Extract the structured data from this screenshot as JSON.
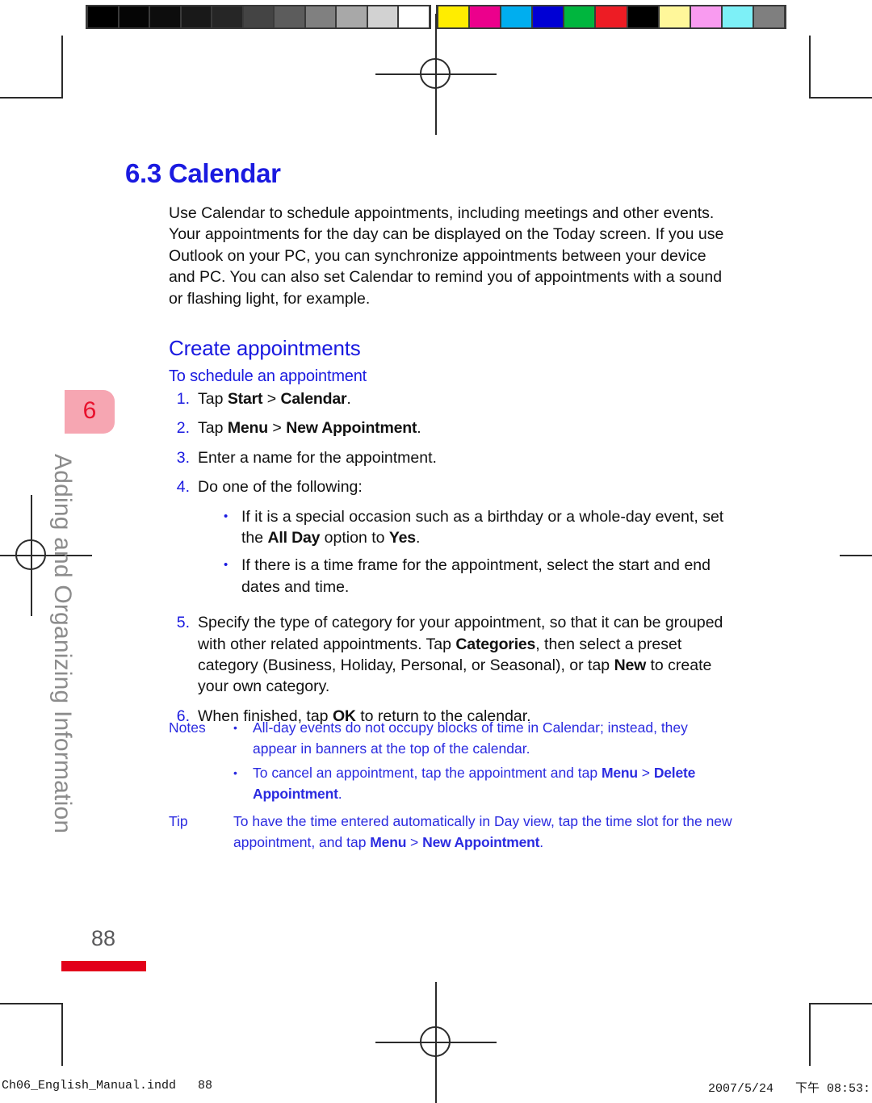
{
  "calibration": {
    "grayscale_label": "grayscale-calibration-strip",
    "grayscale_swatches": [
      "#000000",
      "#050505",
      "#0d0d0d",
      "#191919",
      "#262626",
      "#444444",
      "#5c5c5c",
      "#808080",
      "#a8a8a8",
      "#d2d2d2",
      "#ffffff"
    ],
    "color_label": "color-calibration-strip",
    "color_swatches": [
      "#ffed00",
      "#ec008c",
      "#00aeef",
      "#0000d4",
      "#00b63e",
      "#ed1c24",
      "#000000",
      "#fff79a",
      "#f99bf0",
      "#7df0f7",
      "#7f7f7f"
    ]
  },
  "chapter_tab": {
    "number": "6",
    "vertical_title": "Adding and Organizing Information",
    "tab_color": "#f6a6b2",
    "number_color": "#e8112d",
    "title_color": "#8c8c8c"
  },
  "page": {
    "section_title": "6.3 Calendar",
    "accent_color": "#1a1ae0",
    "intro_paragraph": "Use Calendar to schedule appointments, including meetings and other events. Your appointments for the day can be displayed on the Today screen. If you use Outlook on your PC, you can synchronize appointments between your device and PC. You can also set Calendar to remind you of appointments with a sound or flashing light, for example.",
    "subsection_title": "Create appointments",
    "procedure_title": "To schedule an appointment",
    "page_number": "88",
    "page_rule_color": "#e2001a"
  },
  "steps": [
    {
      "num": "1.",
      "parts": [
        {
          "t": "Tap ",
          "ui": false
        },
        {
          "t": "Start",
          "ui": true
        },
        {
          "t": " > ",
          "ui": false
        },
        {
          "t": "Calendar",
          "ui": true
        },
        {
          "t": ".",
          "ui": false
        }
      ]
    },
    {
      "num": "2.",
      "parts": [
        {
          "t": "Tap ",
          "ui": false
        },
        {
          "t": "Menu",
          "ui": true
        },
        {
          "t": " > ",
          "ui": false
        },
        {
          "t": "New Appointment",
          "ui": true
        },
        {
          "t": ".",
          "ui": false
        }
      ]
    },
    {
      "num": "3.",
      "parts": [
        {
          "t": "Enter a name for the appointment.",
          "ui": false
        }
      ]
    },
    {
      "num": "4.",
      "parts": [
        {
          "t": "Do one of the following:",
          "ui": false
        }
      ],
      "sublist": [
        {
          "bullet": "•",
          "parts": [
            {
              "t": "If it is a special occasion such as a birthday or a whole-day event, set the ",
              "ui": false
            },
            {
              "t": "All Day",
              "ui": true
            },
            {
              "t": " option to ",
              "ui": false
            },
            {
              "t": "Yes",
              "ui": true
            },
            {
              "t": ".",
              "ui": false
            }
          ]
        },
        {
          "bullet": "•",
          "parts": [
            {
              "t": "If there is a time frame for the appointment, select the start and end dates and time.",
              "ui": false
            }
          ]
        }
      ]
    },
    {
      "num": "5.",
      "parts": [
        {
          "t": "Specify the type of category for your appointment, so that it can be grouped with other related appointments. Tap ",
          "ui": false
        },
        {
          "t": "Categories",
          "ui": true
        },
        {
          "t": ", then select a preset category (Business, Holiday, Personal, or Seasonal), or tap ",
          "ui": false
        },
        {
          "t": "New",
          "ui": true
        },
        {
          "t": " to create your own category.",
          "ui": false
        }
      ]
    },
    {
      "num": "6.",
      "parts": [
        {
          "t": "When finished, tap ",
          "ui": false
        },
        {
          "t": "OK",
          "ui": true
        },
        {
          "t": " to return to the calendar.",
          "ui": false
        }
      ]
    }
  ],
  "notes": {
    "label": "Notes",
    "items": [
      {
        "bullet": "•",
        "parts": [
          {
            "t": "All-day events do not occupy blocks of time in Calendar; instead, they appear in banners at the top of the calendar.",
            "ui": false
          }
        ]
      },
      {
        "bullet": "•",
        "parts": [
          {
            "t": "To cancel an appointment, tap the appointment and tap ",
            "ui": false
          },
          {
            "t": "Menu",
            "ui": true
          },
          {
            "t": " > ",
            "ui": false
          },
          {
            "t": "Delete Appointment",
            "ui": true
          },
          {
            "t": ".",
            "ui": false
          }
        ]
      }
    ]
  },
  "tip": {
    "label": "Tip",
    "parts": [
      {
        "t": "To have the time entered automatically in Day view, tap the time slot for the new appointment, and tap ",
        "ui": false
      },
      {
        "t": "Menu",
        "ui": true
      },
      {
        "t": " > ",
        "ui": false
      },
      {
        "t": "New Appointment",
        "ui": true
      },
      {
        "t": ".",
        "ui": false
      }
    ]
  },
  "footer": {
    "file_name": "Ch06_English_Manual.indd   88",
    "date_time": "2007/5/24   下午 08:53:"
  }
}
